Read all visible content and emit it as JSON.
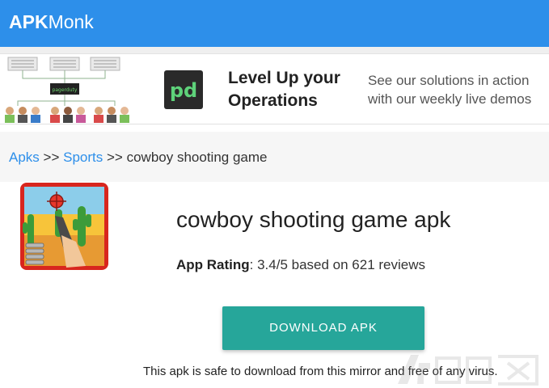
{
  "header": {
    "brand_bold": "APK",
    "brand_rest": "Monk"
  },
  "ad": {
    "art_label": "pagerduty",
    "logo_text": "pd",
    "headline": "Level Up your Operations",
    "subtext": "See our solutions in action with our weekly live demos",
    "brand_color": "#06ac38"
  },
  "breadcrumb": {
    "items": [
      "Apks",
      "Sports"
    ],
    "separator": ">>",
    "current": "cowboy shooting game"
  },
  "app": {
    "title": "cowboy shooting game apk",
    "rating_label": "App Rating",
    "rating_text": ": 3.4/5 based on 621 reviews"
  },
  "download": {
    "label": "DOWNLOAD APK"
  },
  "safety_note": "This apk is safe to download from this mirror and free of any virus.",
  "colors": {
    "header": "#2d8fea",
    "link": "#2d8fea",
    "button": "#26a69a"
  }
}
